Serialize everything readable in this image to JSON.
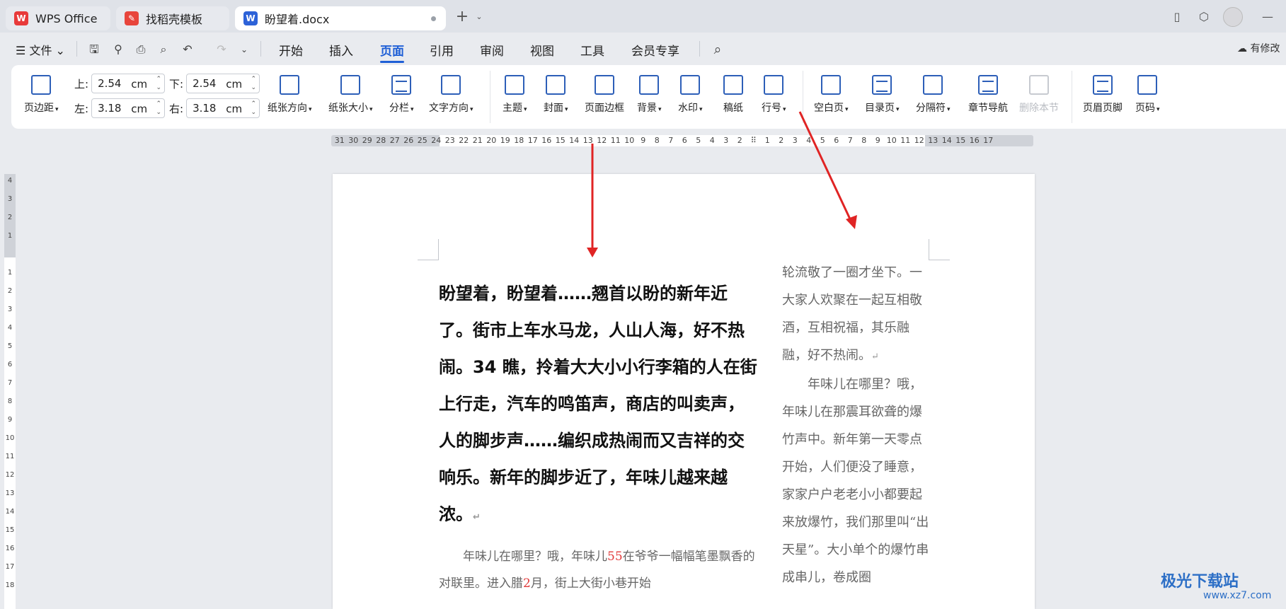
{
  "tabs": [
    {
      "label": "WPS Office",
      "icon": "wps-logo-icon"
    },
    {
      "label": "找稻壳模板",
      "icon": "docer-icon"
    },
    {
      "label": "盼望着.docx",
      "icon": "word-doc-icon"
    }
  ],
  "menu": {
    "file": "文件",
    "items": [
      "开始",
      "插入",
      "页面",
      "引用",
      "审阅",
      "视图",
      "工具",
      "会员专享"
    ],
    "active": "页面"
  },
  "status": {
    "modified": "有修改"
  },
  "ribbon": {
    "margin_button": "页边距",
    "margins": {
      "top_label": "上:",
      "top_value": "2.54",
      "bottom_label": "下:",
      "bottom_value": "2.54",
      "left_label": "左:",
      "left_value": "3.18",
      "right_label": "右:",
      "right_value": "3.18",
      "unit": "cm"
    },
    "buttons": [
      "纸张方向",
      "纸张大小",
      "分栏",
      "文字方向",
      "主题",
      "封面",
      "页面边框",
      "背景",
      "水印",
      "稿纸",
      "行号",
      "空白页",
      "目录页",
      "分隔符",
      "章节导航",
      "删除本节",
      "页眉页脚",
      "页码"
    ]
  },
  "ruler": {
    "h_numbers": [
      "31",
      "30",
      "29",
      "28",
      "27",
      "26",
      "25",
      "24",
      "23",
      "22",
      "21",
      "20",
      "19",
      "18",
      "17",
      "16",
      "15",
      "14",
      "13",
      "12",
      "11",
      "10",
      "9",
      "8",
      "7",
      "6",
      "5",
      "4",
      "3",
      "2",
      "⠿",
      "1",
      "2",
      "3",
      "4",
      "5",
      "6",
      "7",
      "8",
      "9",
      "10",
      "11",
      "12",
      "13",
      "14",
      "15",
      "16",
      "17"
    ],
    "v_numbers": [
      "4",
      "3",
      "2",
      "1",
      "",
      "1",
      "2",
      "3",
      "4",
      "5",
      "6",
      "7",
      "8",
      "9",
      "10",
      "11",
      "12",
      "13",
      "14",
      "15",
      "16",
      "17",
      "18"
    ]
  },
  "document": {
    "bold_paragraph": "盼望着，盼望着……翘首以盼的新年近了。街市上车水马龙，人山人海，好不热闹。34 瞧，拎着大大小小行李箱的人在街上行走，汽车的鸣笛声，商店的叫卖声，人的脚步声……编织成热闹而又吉祥的交响乐。新年的脚步近了，年味儿越来越浓。",
    "normal_paragraph_a": "年味儿在哪里？哦，年味儿",
    "normal_num_a": "55",
    "normal_paragraph_b": "在爷爷一幅幅笔墨飘香的对联里。进入腊",
    "normal_num_b": "2",
    "normal_paragraph_c": "月，街上大街小巷开始",
    "right_para_1": "轮流敬了一圈才坐下。一大家人欢聚在一起互相敬酒，互相祝福，其乐融融，好不热闹。",
    "right_para_2": "年味儿在哪里？哦，年味儿在那震耳欲聋的爆竹声中。新年第一天零点开始，人们便没了睡意，家家户户老老小小都要起来放爆竹，我们那里叫“出天星”。大小单个的爆竹串成串儿，卷成圈",
    "para_mark": "↵"
  },
  "watermark": {
    "name": "极光下载站",
    "url": "www.xz7.com"
  },
  "colors": {
    "accent": "#1f5fd6",
    "arrow": "#e02424",
    "red_number": "#e23b3b"
  }
}
